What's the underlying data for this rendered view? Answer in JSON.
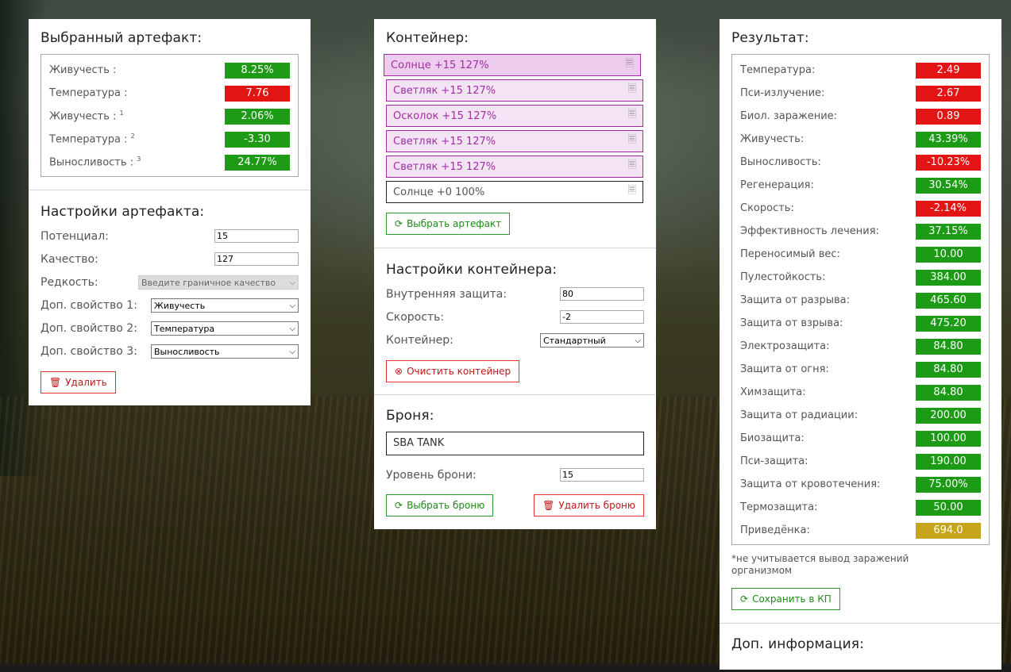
{
  "artifact": {
    "selected_title": "Выбранный артефакт:",
    "stats": [
      {
        "label": "Живучесть :",
        "sup": "",
        "value": "8.25%",
        "color": "green"
      },
      {
        "label": "Температура :",
        "sup": "",
        "value": "7.76",
        "color": "red"
      },
      {
        "label": "Живучесть :",
        "sup": "1",
        "value": "2.06%",
        "color": "green"
      },
      {
        "label": "Температура :",
        "sup": "2",
        "value": "-3.30",
        "color": "green"
      },
      {
        "label": "Выносливость :",
        "sup": "3",
        "value": "24.77%",
        "color": "green"
      }
    ],
    "settings_title": "Настройки артефакта:",
    "potential_label": "Потенциал:",
    "potential_value": "15",
    "quality_label": "Качество:",
    "quality_value": "127",
    "rarity_label": "Редкость:",
    "rarity_value": "Введите граничное качество",
    "prop1_label": "Доп. свойство 1:",
    "prop1_value": "Живучесть",
    "prop2_label": "Доп. свойство 2:",
    "prop2_value": "Температура",
    "prop3_label": "Доп. свойство 3:",
    "prop3_value": "Выносливость",
    "delete_label": "Удалить"
  },
  "container": {
    "title": "Контейнер:",
    "slots": [
      "Солнце +15 127%",
      "Светляк +15 127%",
      "Осколок +15 127%",
      "Светляк +15 127%",
      "Светляк +15 127%",
      "Солнце +0 100%"
    ],
    "select_artifact_label": "Выбрать артефакт",
    "settings_title": "Настройки контейнера:",
    "inner_protection_label": "Внутренняя защита:",
    "inner_protection_value": "80",
    "speed_label": "Скорость:",
    "speed_value": "-2",
    "container_label": "Контейнер:",
    "container_value": "Стандартный",
    "clear_label": "Очистить контейнер"
  },
  "armor": {
    "title": "Броня:",
    "name": "SBA TANK",
    "level_label": "Уровень брони:",
    "level_value": "15",
    "select_label": "Выбрать броню",
    "delete_label": "Удалить броню"
  },
  "result": {
    "title": "Результат:",
    "stats": [
      {
        "label": "Температура:",
        "value": "2.49",
        "color": "red"
      },
      {
        "label": "Пси-излучение:",
        "value": "2.67",
        "color": "red"
      },
      {
        "label": "Биол. заражение:",
        "value": "0.89",
        "color": "red"
      },
      {
        "label": "Живучесть:",
        "value": "43.39%",
        "color": "green"
      },
      {
        "label": "Выносливость:",
        "value": "-10.23%",
        "color": "red"
      },
      {
        "label": "Регенерация:",
        "value": "30.54%",
        "color": "green"
      },
      {
        "label": "Скорость:",
        "value": "-2.14%",
        "color": "red"
      },
      {
        "label": "Эффективность лечения:",
        "value": "37.15%",
        "color": "green"
      },
      {
        "label": "Переносимый вес:",
        "value": "10.00",
        "color": "green"
      },
      {
        "label": "Пулестойкость:",
        "value": "384.00",
        "color": "green"
      },
      {
        "label": "Защита от разрыва:",
        "value": "465.60",
        "color": "green"
      },
      {
        "label": "Защита от взрыва:",
        "value": "475.20",
        "color": "green"
      },
      {
        "label": "Электрозащита:",
        "value": "84.80",
        "color": "green"
      },
      {
        "label": "Защита от огня:",
        "value": "84.80",
        "color": "green"
      },
      {
        "label": "Химзащита:",
        "value": "84.80",
        "color": "green"
      },
      {
        "label": "Защита от радиации:",
        "value": "200.00",
        "color": "green"
      },
      {
        "label": "Биозащита:",
        "value": "100.00",
        "color": "green"
      },
      {
        "label": "Пси-защита:",
        "value": "190.00",
        "color": "green"
      },
      {
        "label": "Защита от кровотечения:",
        "value": "75.00%",
        "color": "green"
      },
      {
        "label": "Термозащита:",
        "value": "50.00",
        "color": "green"
      },
      {
        "label": "Приведёнка:",
        "value": "694.0",
        "color": "gold"
      }
    ],
    "note": "*не учитывается вывод заражений организмом",
    "save_label": "Сохранить в КП",
    "extra_title": "Доп. информация:"
  },
  "colors": {
    "green": "#1d9a16",
    "red": "#e31414",
    "gold": "#c6a51c",
    "slot_border": "#a52ba5",
    "slot_bg": "#f4e3f4"
  }
}
